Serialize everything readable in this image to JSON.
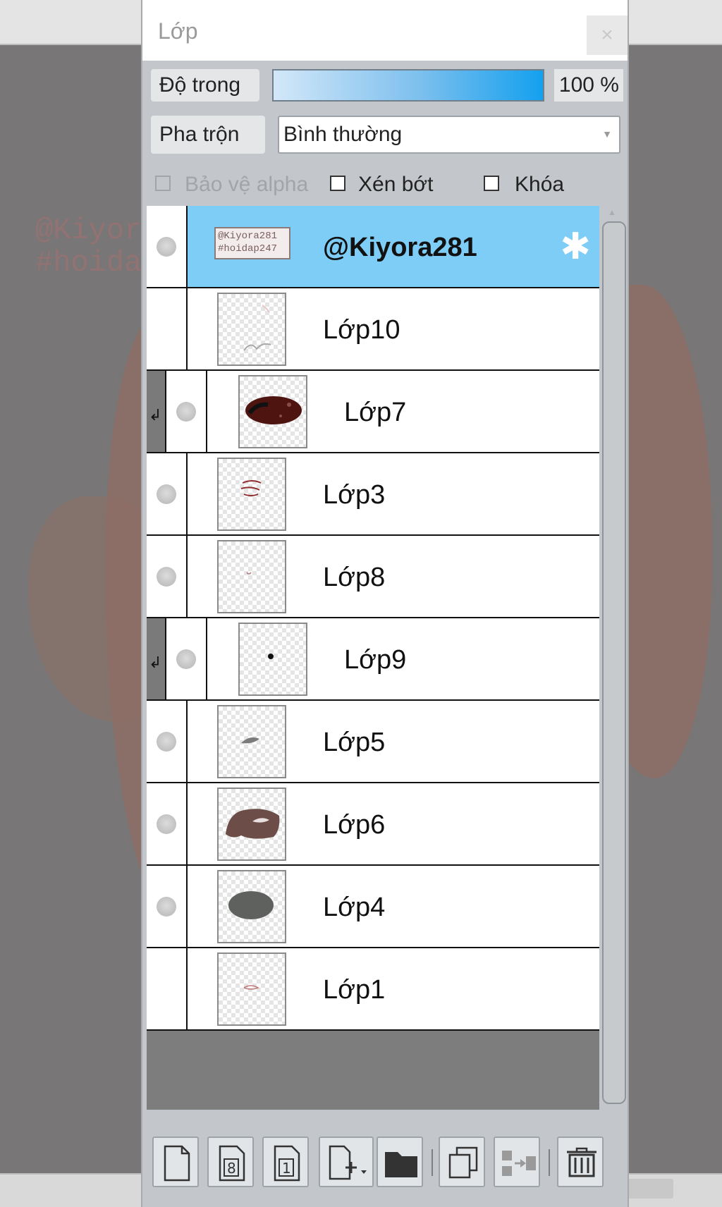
{
  "panel": {
    "title": "Lớp",
    "close_label": "×"
  },
  "opacity": {
    "label": "Độ trong",
    "value": "100 %",
    "level_percent": 100
  },
  "blend": {
    "label": "Pha trộn",
    "selected": "Bình thường"
  },
  "options": [
    {
      "label": "Bảo vệ alpha",
      "checked": false,
      "enabled": false
    },
    {
      "label": "Xén bớt",
      "checked": false,
      "enabled": true
    },
    {
      "label": "Khóa",
      "checked": false,
      "enabled": true
    }
  ],
  "layers": [
    {
      "name": "@Kiyora281",
      "selected": true,
      "visible_toggle": true,
      "clipped": false,
      "thumb_text": [
        "@Kiyora281",
        "#hoidap247"
      ]
    },
    {
      "name": "Lớp10",
      "selected": false,
      "visible_toggle": false,
      "clipped": false
    },
    {
      "name": "Lớp7",
      "selected": false,
      "visible_toggle": true,
      "clipped": true
    },
    {
      "name": "Lớp3",
      "selected": false,
      "visible_toggle": true,
      "clipped": false
    },
    {
      "name": "Lớp8",
      "selected": false,
      "visible_toggle": true,
      "clipped": false
    },
    {
      "name": "Lớp9",
      "selected": false,
      "visible_toggle": true,
      "clipped": true
    },
    {
      "name": "Lớp5",
      "selected": false,
      "visible_toggle": true,
      "clipped": false
    },
    {
      "name": "Lớp6",
      "selected": false,
      "visible_toggle": true,
      "clipped": false
    },
    {
      "name": "Lớp4",
      "selected": false,
      "visible_toggle": true,
      "clipped": false
    },
    {
      "name": "Lớp1",
      "selected": false,
      "visible_toggle": false,
      "clipped": false
    }
  ],
  "background_watermark": [
    "@Kiyora",
    "#hoida"
  ],
  "toolbar_icons": [
    "new-layer-icon",
    "new-8bit-layer-icon",
    "new-1bit-layer-icon",
    "add-layer-menu-icon",
    "folder-icon",
    "duplicate-layer-icon",
    "merge-down-icon",
    "delete-icon"
  ],
  "colors": {
    "selected_row": "#7ecdf7",
    "opacity_bar": "#14a0ee"
  }
}
